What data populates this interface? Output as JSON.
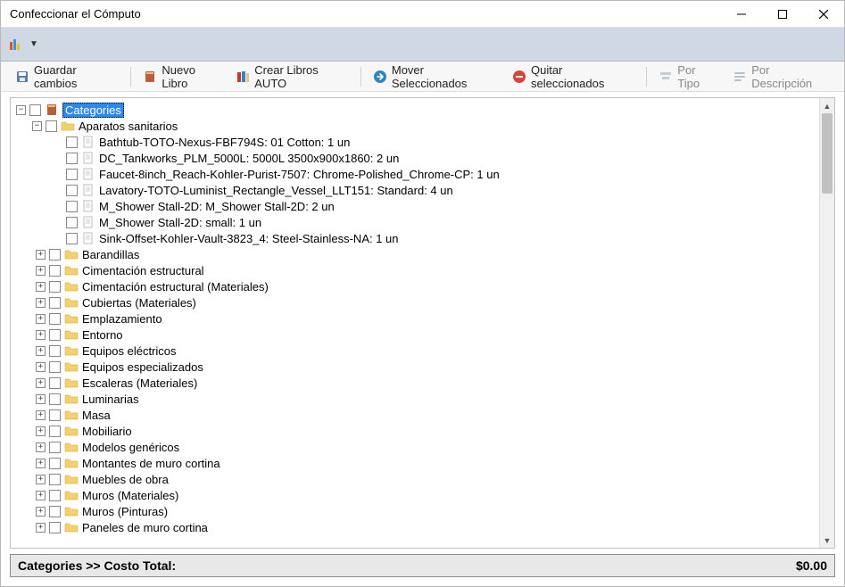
{
  "window": {
    "title": "Confeccionar el Cómputo"
  },
  "toolbar": {
    "save": "Guardar cambios",
    "new_book": "Nuevo Libro",
    "create_auto": "Crear Libros AUTO",
    "move_sel": "Mover Seleccionados",
    "remove_sel": "Quitar seleccionados",
    "by_type": "Por Tipo",
    "by_desc": "Por Descripción"
  },
  "tree": {
    "root": "Categories",
    "open_folder": "Aparatos sanitarios",
    "leaves": [
      "Bathtub-TOTO-Nexus-FBF794S: 01 Cotton: 1 un",
      "DC_Tankworks_PLM_5000L: 5000L 3500x900x1860: 2 un",
      "Faucet-8inch_Reach-Kohler-Purist-7507: Chrome-Polished_Chrome-CP: 1 un",
      "Lavatory-TOTO-Luminist_Rectangle_Vessel_LLT151: Standard: 4 un",
      "M_Shower Stall-2D: M_Shower Stall-2D: 2 un",
      "M_Shower Stall-2D: small: 1 un",
      "Sink-Offset-Kohler-Vault-3823_4: Steel-Stainless-NA: 1 un"
    ],
    "collapsed": [
      "Barandillas",
      "Cimentación estructural",
      "Cimentación estructural (Materiales)",
      "Cubiertas (Materiales)",
      "Emplazamiento",
      "Entorno",
      "Equipos eléctricos",
      "Equipos especializados",
      "Escaleras (Materiales)",
      "Luminarias",
      "Masa",
      "Mobiliario",
      "Modelos genéricos",
      "Montantes de muro cortina",
      "Muebles de obra",
      "Muros (Materiales)",
      "Muros (Pinturas)",
      "Paneles de muro cortina"
    ]
  },
  "status": {
    "path": "Categories >> Costo Total:",
    "value": "$0.00"
  }
}
